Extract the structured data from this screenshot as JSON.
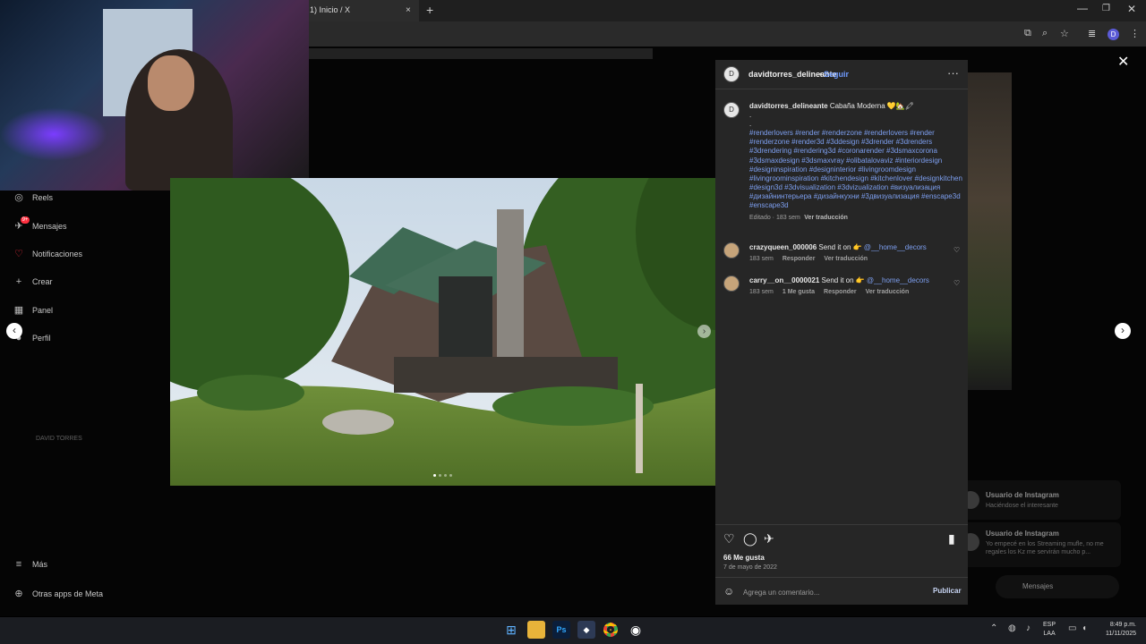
{
  "browser": {
    "tab_title": "1) Inicio / X",
    "tab_close": "×",
    "new_tab": "+",
    "window_controls": {
      "minimize": "—",
      "maximize": "❐",
      "close": "✕"
    },
    "toolbar_icons": [
      "cast-icon",
      "zoom-icon",
      "star-icon",
      "media-icon",
      "profile-icon",
      "menu-icon"
    ],
    "profile_initial": "D"
  },
  "sidebar": {
    "items": [
      {
        "label": "Reels",
        "icon": "reels-icon",
        "glyph": "◎"
      },
      {
        "label": "Mensajes",
        "icon": "messages-icon",
        "glyph": "✈"
      },
      {
        "label": "Notificaciones",
        "icon": "heart-icon",
        "glyph": "♡"
      },
      {
        "label": "Crear",
        "icon": "plus-icon",
        "glyph": "+"
      },
      {
        "label": "Panel",
        "icon": "dashboard-icon",
        "glyph": "▦"
      },
      {
        "label": "Perfil",
        "icon": "profile-icon",
        "glyph": "●"
      }
    ],
    "bottom": [
      {
        "label": "Más",
        "icon": "hamburger-icon",
        "glyph": "≡"
      },
      {
        "label": "Otras apps de Meta",
        "icon": "meta-apps-icon",
        "glyph": "⊕"
      }
    ],
    "messages_badge": "9+"
  },
  "post": {
    "author": "davidtorres_delineante",
    "follow": "Seguir",
    "separator": "•",
    "more": "···",
    "avatar_glyph": "D",
    "caption_title": "Cabaña Moderna 💛🏡🖍",
    "caption_dots": [
      ".",
      "."
    ],
    "hashtags": "#renderlovers #render #renderzone #renderlovers #render #renderzone #render3d #3ddesign #3drender #3drenders #3drendering #rendering3d #coronarender #3dsmaxcorona #3dsmaxdesign #3dsmaxvray #olibatalovaviz #interiordesign #designinspiration #designinterior #livingroomdesign #livingroominspiration #kitchendesign #kitchenlover #designkitchen #design3d #3dvisualization #3dvizualization #визуализация #дизайнинтерьера #дизайнкухни #3двизуализация #enscape3d #enscape3d",
    "caption_meta": "Editado · 183 sem",
    "caption_translate": "Ver traducción",
    "comments": [
      {
        "user": "crazyqueen_000006",
        "text": "Send it on 👉",
        "mention": "@__home__decors",
        "time": "183 sem",
        "likes": "",
        "reply": "Responder",
        "translate": "Ver traducción"
      },
      {
        "user": "carry__on__0000021",
        "text": "Send it on 👉",
        "mention": "@__home__decors",
        "time": "183 sem",
        "likes": "1 Me gusta",
        "reply": "Responder",
        "translate": "Ver traducción"
      }
    ],
    "likes": "66 Me gusta",
    "date": "7 de mayo de 2022",
    "comment_placeholder": "Agrega un comentario...",
    "publish": "Publicar",
    "image_watermark": "DAVID TORRES",
    "carousel_slides": 4,
    "carousel_active": 1
  },
  "notifications": [
    {
      "title": "Usuario de Instagram",
      "body": "Haciéndose el interesante"
    },
    {
      "title": "Usuario de Instagram",
      "body": "Yo empecé en los Streaming mufle, no me regales los Kz me servirán mucho p..."
    }
  ],
  "messages_pill": {
    "label": "Mensajes",
    "badge": "9+"
  },
  "modal": {
    "close": "✕",
    "prev": "‹",
    "next": "›"
  },
  "taskbar": {
    "apps": [
      "windows-start-icon",
      "file-explorer-icon",
      "photoshop-icon",
      "app-icon",
      "chrome-icon",
      "obs-icon"
    ],
    "ps_label": "Ps",
    "lang_top": "ESP",
    "lang_bottom": "LAA",
    "time": "8:49 p.m.",
    "date": "11/11/2025"
  },
  "colors": {
    "accent": "#0095f6",
    "link": "#7d9ff0",
    "panel": "#262626",
    "badge": "#ff3040"
  }
}
